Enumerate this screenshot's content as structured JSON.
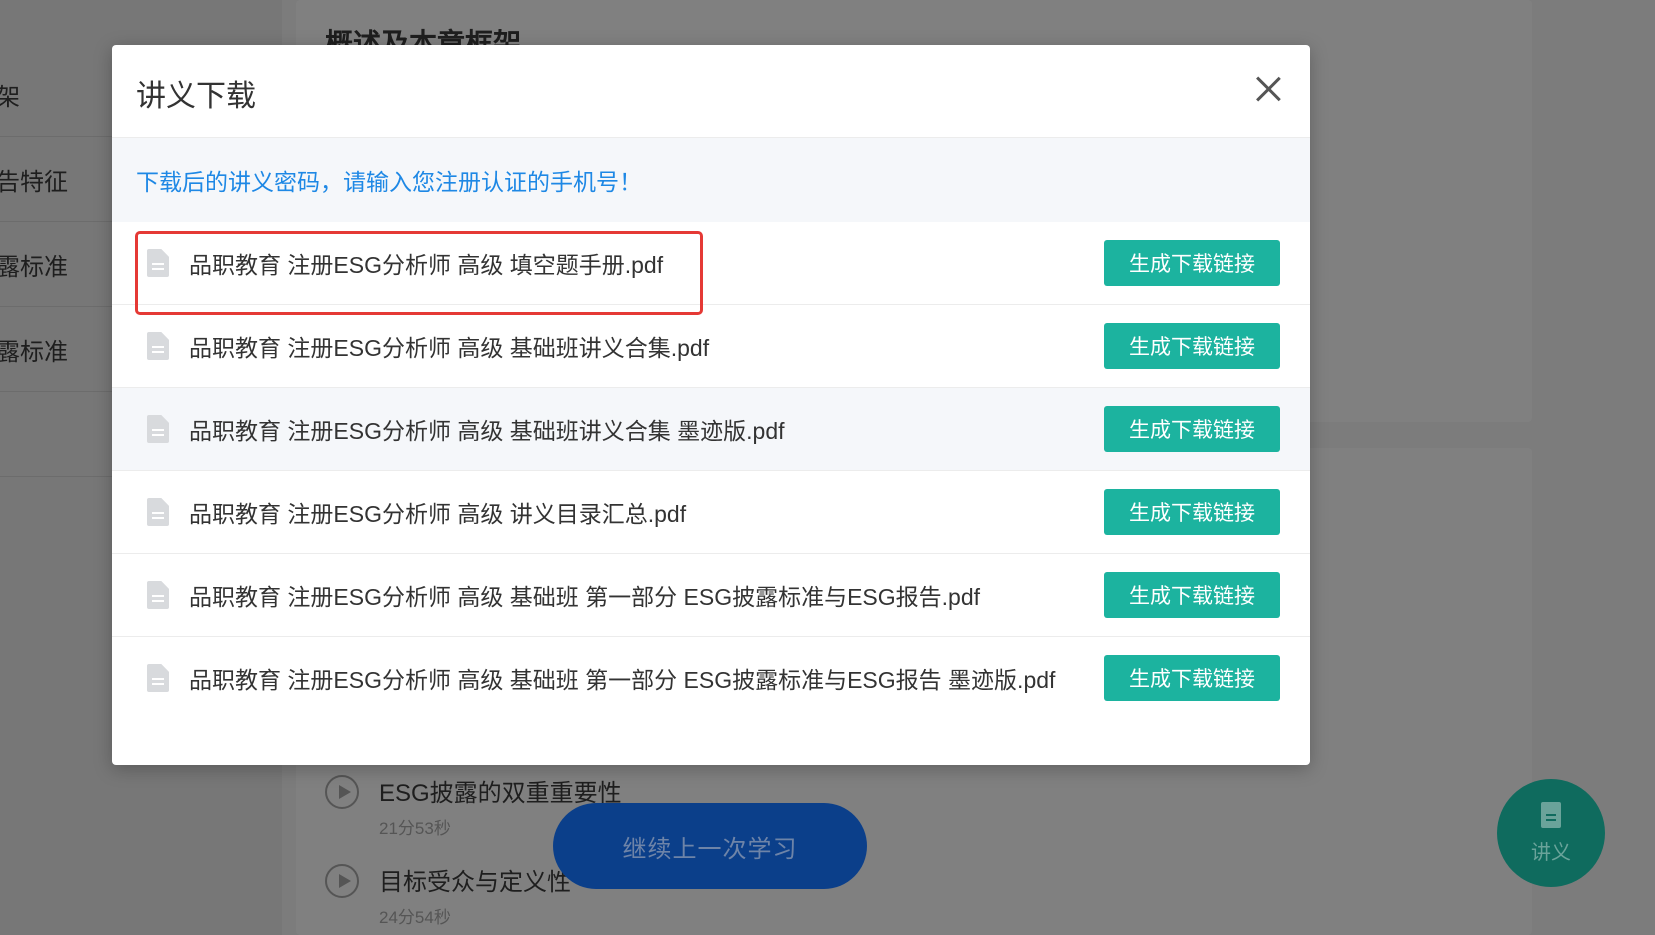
{
  "background": {
    "sidebar_items": [
      "框架",
      "报告特征",
      "披露标准",
      "披露标准",
      ""
    ],
    "section_heading": "概述及本章框架",
    "lessons": [
      {
        "title": "ESG披露的双重重要性",
        "duration": "21分53秒"
      },
      {
        "title": "目标受众与定义性",
        "duration": "24分54秒"
      }
    ],
    "continue_label": "继续上一次学习",
    "notes_fab_label": "讲义",
    "notes_fab_icon": "document-icon"
  },
  "modal": {
    "title": "讲义下载",
    "close_icon": "close-icon",
    "notice": "下载后的讲义密码，请输入您注册认证的手机号！",
    "button_label": "生成下载链接",
    "file_icon": "file-icon",
    "files": [
      {
        "name": "品职教育 注册ESG分析师 高级 填空题手册.pdf"
      },
      {
        "name": "品职教育 注册ESG分析师 高级 基础班讲义合集.pdf"
      },
      {
        "name": "品职教育 注册ESG分析师 高级 基础班讲义合集 墨迹版.pdf"
      },
      {
        "name": "品职教育 注册ESG分析师 高级 讲义目录汇总.pdf"
      },
      {
        "name": "品职教育 注册ESG分析师 高级 基础班 第一部分 ESG披露标准与ESG报告.pdf"
      },
      {
        "name": "品职教育 注册ESG分析师 高级 基础班 第一部分 ESG披露标准与ESG报告 墨迹版.pdf"
      }
    ]
  },
  "colors": {
    "accent_button": "#1cb39f",
    "notice_text": "#1e88e5",
    "highlight_border": "#e53935"
  }
}
